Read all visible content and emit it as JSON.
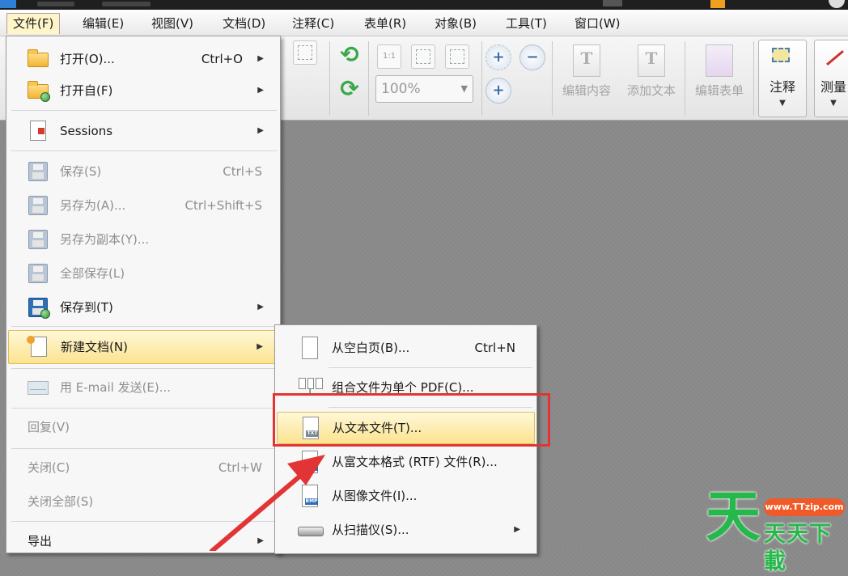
{
  "menubar": {
    "items": [
      "文件(F)",
      "编辑(E)",
      "视图(V)",
      "文档(D)",
      "注释(C)",
      "表单(R)",
      "对象(B)",
      "工具(T)",
      "窗口(W)"
    ],
    "active_index": 0
  },
  "toolbar": {
    "zoom_value": "100%",
    "zoom_actual_label": "1:1",
    "edit_content_label": "编辑内容",
    "add_text_label": "添加文本",
    "edit_form_label": "编辑表单",
    "annotate_label": "注释",
    "measure_label": "测量"
  },
  "file_menu": {
    "items": [
      {
        "label": "打开(O)...",
        "shortcut": "Ctrl+O",
        "submenu": true,
        "enabled": true,
        "icon": "folder-open-icon"
      },
      {
        "label": "打开自(F)",
        "shortcut": "",
        "submenu": true,
        "enabled": true,
        "icon": "folder-web-icon"
      },
      {
        "label": "Sessions",
        "shortcut": "",
        "submenu": true,
        "enabled": true,
        "icon": "sessions-icon"
      },
      {
        "label": "保存(S)",
        "shortcut": "Ctrl+S",
        "submenu": false,
        "enabled": false,
        "icon": "save-icon"
      },
      {
        "label": "另存为(A)...",
        "shortcut": "Ctrl+Shift+S",
        "submenu": false,
        "enabled": false,
        "icon": "save-as-icon"
      },
      {
        "label": "另存为副本(Y)...",
        "shortcut": "",
        "submenu": false,
        "enabled": false,
        "icon": "save-copy-icon"
      },
      {
        "label": "全部保存(L)",
        "shortcut": "",
        "submenu": false,
        "enabled": false,
        "icon": "save-all-icon"
      },
      {
        "label": "保存到(T)",
        "shortcut": "",
        "submenu": true,
        "enabled": true,
        "icon": "save-to-icon"
      },
      {
        "label": "新建文档(N)",
        "shortcut": "",
        "submenu": true,
        "enabled": true,
        "icon": "new-document-icon"
      },
      {
        "label": "用 E-mail 发送(E)...",
        "shortcut": "",
        "submenu": false,
        "enabled": false,
        "icon": "email-icon"
      },
      {
        "label": "回复(V)",
        "shortcut": "",
        "submenu": false,
        "enabled": false,
        "icon": ""
      },
      {
        "label": "关闭(C)",
        "shortcut": "Ctrl+W",
        "submenu": false,
        "enabled": false,
        "icon": ""
      },
      {
        "label": "关闭全部(S)",
        "shortcut": "",
        "submenu": false,
        "enabled": false,
        "icon": ""
      },
      {
        "label": "导出",
        "shortcut": "",
        "submenu": true,
        "enabled": true,
        "icon": ""
      }
    ]
  },
  "new_doc_submenu": {
    "items": [
      {
        "label": "从空白页(B)...",
        "shortcut": "Ctrl+N",
        "submenu": false,
        "icon": "blank-page-icon"
      },
      {
        "label": "组合文件为单个 PDF(C)...",
        "shortcut": "",
        "submenu": false,
        "icon": "combine-files-icon"
      },
      {
        "label": "从文本文件(T)...",
        "shortcut": "",
        "submenu": false,
        "icon": "txt-file-icon",
        "file_tag": "TXT"
      },
      {
        "label": "从富文本格式 (RTF) 文件(R)...",
        "shortcut": "",
        "submenu": false,
        "icon": "rtf-file-icon",
        "file_tag": "RTF"
      },
      {
        "label": "从图像文件(I)...",
        "shortcut": "",
        "submenu": false,
        "icon": "bmp-file-icon",
        "file_tag": "BMP"
      },
      {
        "label": "从扫描仪(S)...",
        "shortcut": "",
        "submenu": true,
        "icon": "scanner-icon"
      }
    ]
  },
  "watermark": {
    "logo_char": "天",
    "url": "www.TTzip.com",
    "name": "天天下載"
  },
  "colors": {
    "highlight": "#fbe38f",
    "annotation_red": "#e23434",
    "watermark_green": "#25b84a",
    "watermark_orange": "#f05a28"
  }
}
